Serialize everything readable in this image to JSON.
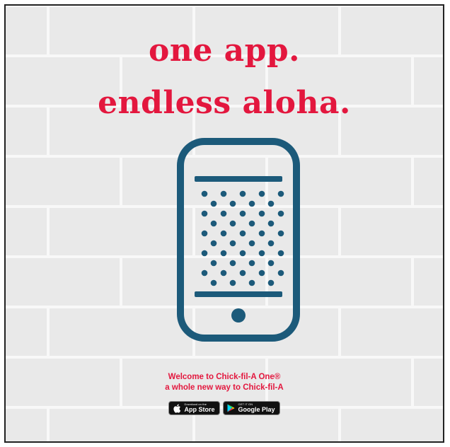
{
  "colors": {
    "accent": "#e3173e",
    "phone_stroke": "#1c5a7a",
    "wall": "#e9e9e9"
  },
  "headline": {
    "line1": "one app.",
    "line2": "endless aloha."
  },
  "phone": {
    "icon": "smartphone-icon"
  },
  "caption": {
    "line1": "Welcome to Chick-fil-A One®",
    "line2": "a whole new way to Chick-fil-A"
  },
  "badges": {
    "app_store": {
      "small": "Download on the",
      "large": "App Store",
      "icon": "apple-icon"
    },
    "google_play": {
      "small": "GET IT ON",
      "large": "Google Play",
      "icon": "google-play-icon"
    }
  }
}
